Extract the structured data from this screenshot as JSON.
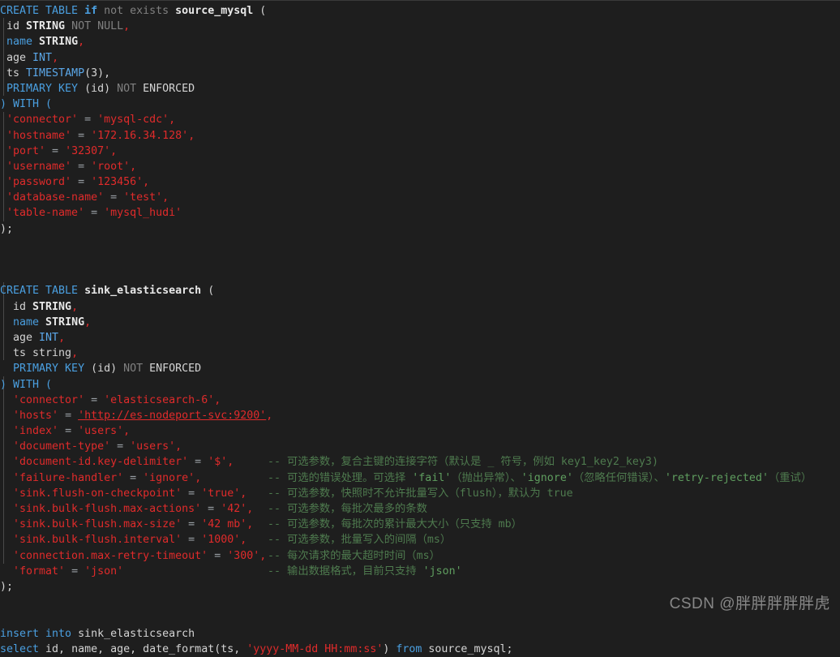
{
  "editor": {
    "language": "sql",
    "theme": "dark",
    "background_color": "#1e1e1e",
    "colors": {
      "keyword": "#4a9fe0",
      "string": "#e02b2b",
      "comment": "#4e7a4e",
      "dim": "#808080",
      "text": "#d4d4d4",
      "operator": "#9aa0a6"
    }
  },
  "lines": {
    "l1_create": "CREATE TABLE ",
    "l1_if": "if",
    "l1_notexists": " not exists ",
    "l1_name": "source_mysql",
    "l1_paren": " (",
    "l2": " id STRING NOT NULL,",
    "l2_id": " id ",
    "l2_type": "STRING",
    "l2_not": " NOT NULL",
    "l2_comma": ",",
    "l3_name": " name ",
    "l3_type": "STRING",
    "l3_comma": ",",
    "l4_name": " age ",
    "l4_type": "INT",
    "l4_comma": ",",
    "l5_name": " ts ",
    "l5_type": "TIMESTAMP",
    "l5_args": "(3),",
    "l6_pk": " PRIMARY KEY ",
    "l6_id": "(id)",
    "l6_not": " NOT ",
    "l6_enf": "ENFORCED",
    "l7_with": ") WITH (",
    "src_props": [
      {
        "key": "'connector'",
        "value": "'mysql-cdc'",
        "comma": ","
      },
      {
        "key": "'hostname'",
        "value": "'172.16.34.128'",
        "comma": ","
      },
      {
        "key": "'port'",
        "value": "'32307'",
        "comma": ","
      },
      {
        "key": "'username'",
        "value": "'root'",
        "comma": ","
      },
      {
        "key": "'password'",
        "value": "'123456'",
        "comma": ","
      },
      {
        "key": "'database-name'",
        "value": "'test'",
        "comma": ","
      },
      {
        "key": "'table-name'",
        "value": "'mysql_hudi'",
        "comma": ""
      }
    ],
    "close_stmt": ");",
    "l2_create": "CREATE TABLE ",
    "l2_tablename": "sink_elasticsearch",
    "l2_paren": " (",
    "sink_cols": [
      {
        "indent": "  ",
        "name": "id ",
        "type": "STRING",
        "type_class": "type",
        "tail": ","
      },
      {
        "indent": "  ",
        "name": "name ",
        "type": "STRING",
        "type_class": "type",
        "tail": ","
      },
      {
        "indent": "  ",
        "name": "age ",
        "type": "INT",
        "type_class": "type",
        "tail": ","
      },
      {
        "indent": "  ",
        "name": "ts ",
        "type": "string",
        "type_class": "plain",
        "tail": ","
      }
    ],
    "sink_pk": "  PRIMARY KEY ",
    "sink_pk_id": "(id)",
    "sink_pk_not": " NOT ",
    "sink_pk_enf": "ENFORCED",
    "sink_with": ") WITH (",
    "sink_props": [
      {
        "key": "'connector'",
        "value": "'elasticsearch-6'",
        "comma": ",",
        "link": false,
        "comment": ""
      },
      {
        "key": "'hosts'",
        "value": "'http://es-nodeport-svc:9200'",
        "comma": ",",
        "link": true,
        "comment": ""
      },
      {
        "key": "'index'",
        "value": "'users'",
        "comma": ",",
        "link": false,
        "comment": ""
      },
      {
        "key": "'document-type'",
        "value": "'users'",
        "comma": ",",
        "link": false,
        "comment": ""
      },
      {
        "key": "'document-id.key-delimiter'",
        "value": "'$'",
        "comma": ",",
        "link": false,
        "comment": "-- 可选参数，复合主键的连接字符（默认是 _ 符号，例如 key1_key2_key3)"
      },
      {
        "key": "'failure-handler'",
        "value": "'ignore'",
        "comma": ",",
        "link": false,
        "comment": "-- 可选的错误处理。可选择 'fail'（抛出异常）、'ignore'（忽略任何错误）、'retry-rejected'（重试）"
      },
      {
        "key": "'sink.flush-on-checkpoint'",
        "value": "'true'",
        "comma": ",",
        "link": false,
        "comment": "-- 可选参数，快照时不允许批量写入（flush），默认为 true"
      },
      {
        "key": "'sink.bulk-flush.max-actions'",
        "value": "'42'",
        "comma": ",",
        "link": false,
        "comment": "-- 可选参数，每批次最多的条数"
      },
      {
        "key": "'sink.bulk-flush.max-size'",
        "value": "'42 mb'",
        "comma": ",",
        "link": false,
        "comment": "-- 可选参数，每批次的累计最大大小（只支持 mb）"
      },
      {
        "key": "'sink.bulk-flush.interval'",
        "value": "'1000'",
        "comma": ",",
        "link": false,
        "comment": "-- 可选参数，批量写入的间隔（ms）"
      },
      {
        "key": "'connection.max-retry-timeout'",
        "value": "'300'",
        "comma": ",",
        "link": false,
        "comment": "-- 每次请求的最大超时时间（ms）"
      },
      {
        "key": "'format'",
        "value": "'json'",
        "comma": "",
        "link": false,
        "comment": "-- 输出数据格式，目前只支持 'json'"
      }
    ],
    "close_stmt2": ");",
    "ins_insert": "insert into ",
    "ins_table": "sink_elasticsearch",
    "sel_select": "select ",
    "sel_cols": "id, name, age, ",
    "sel_fn": "date_format(ts, ",
    "sel_fmt": "'yyyy-MM-dd HH:mm:ss'",
    "sel_close": ") ",
    "sel_from": "from ",
    "sel_src": "source_mysql;"
  },
  "watermark": {
    "text": "CSDN @胖胖胖胖胖虎"
  }
}
